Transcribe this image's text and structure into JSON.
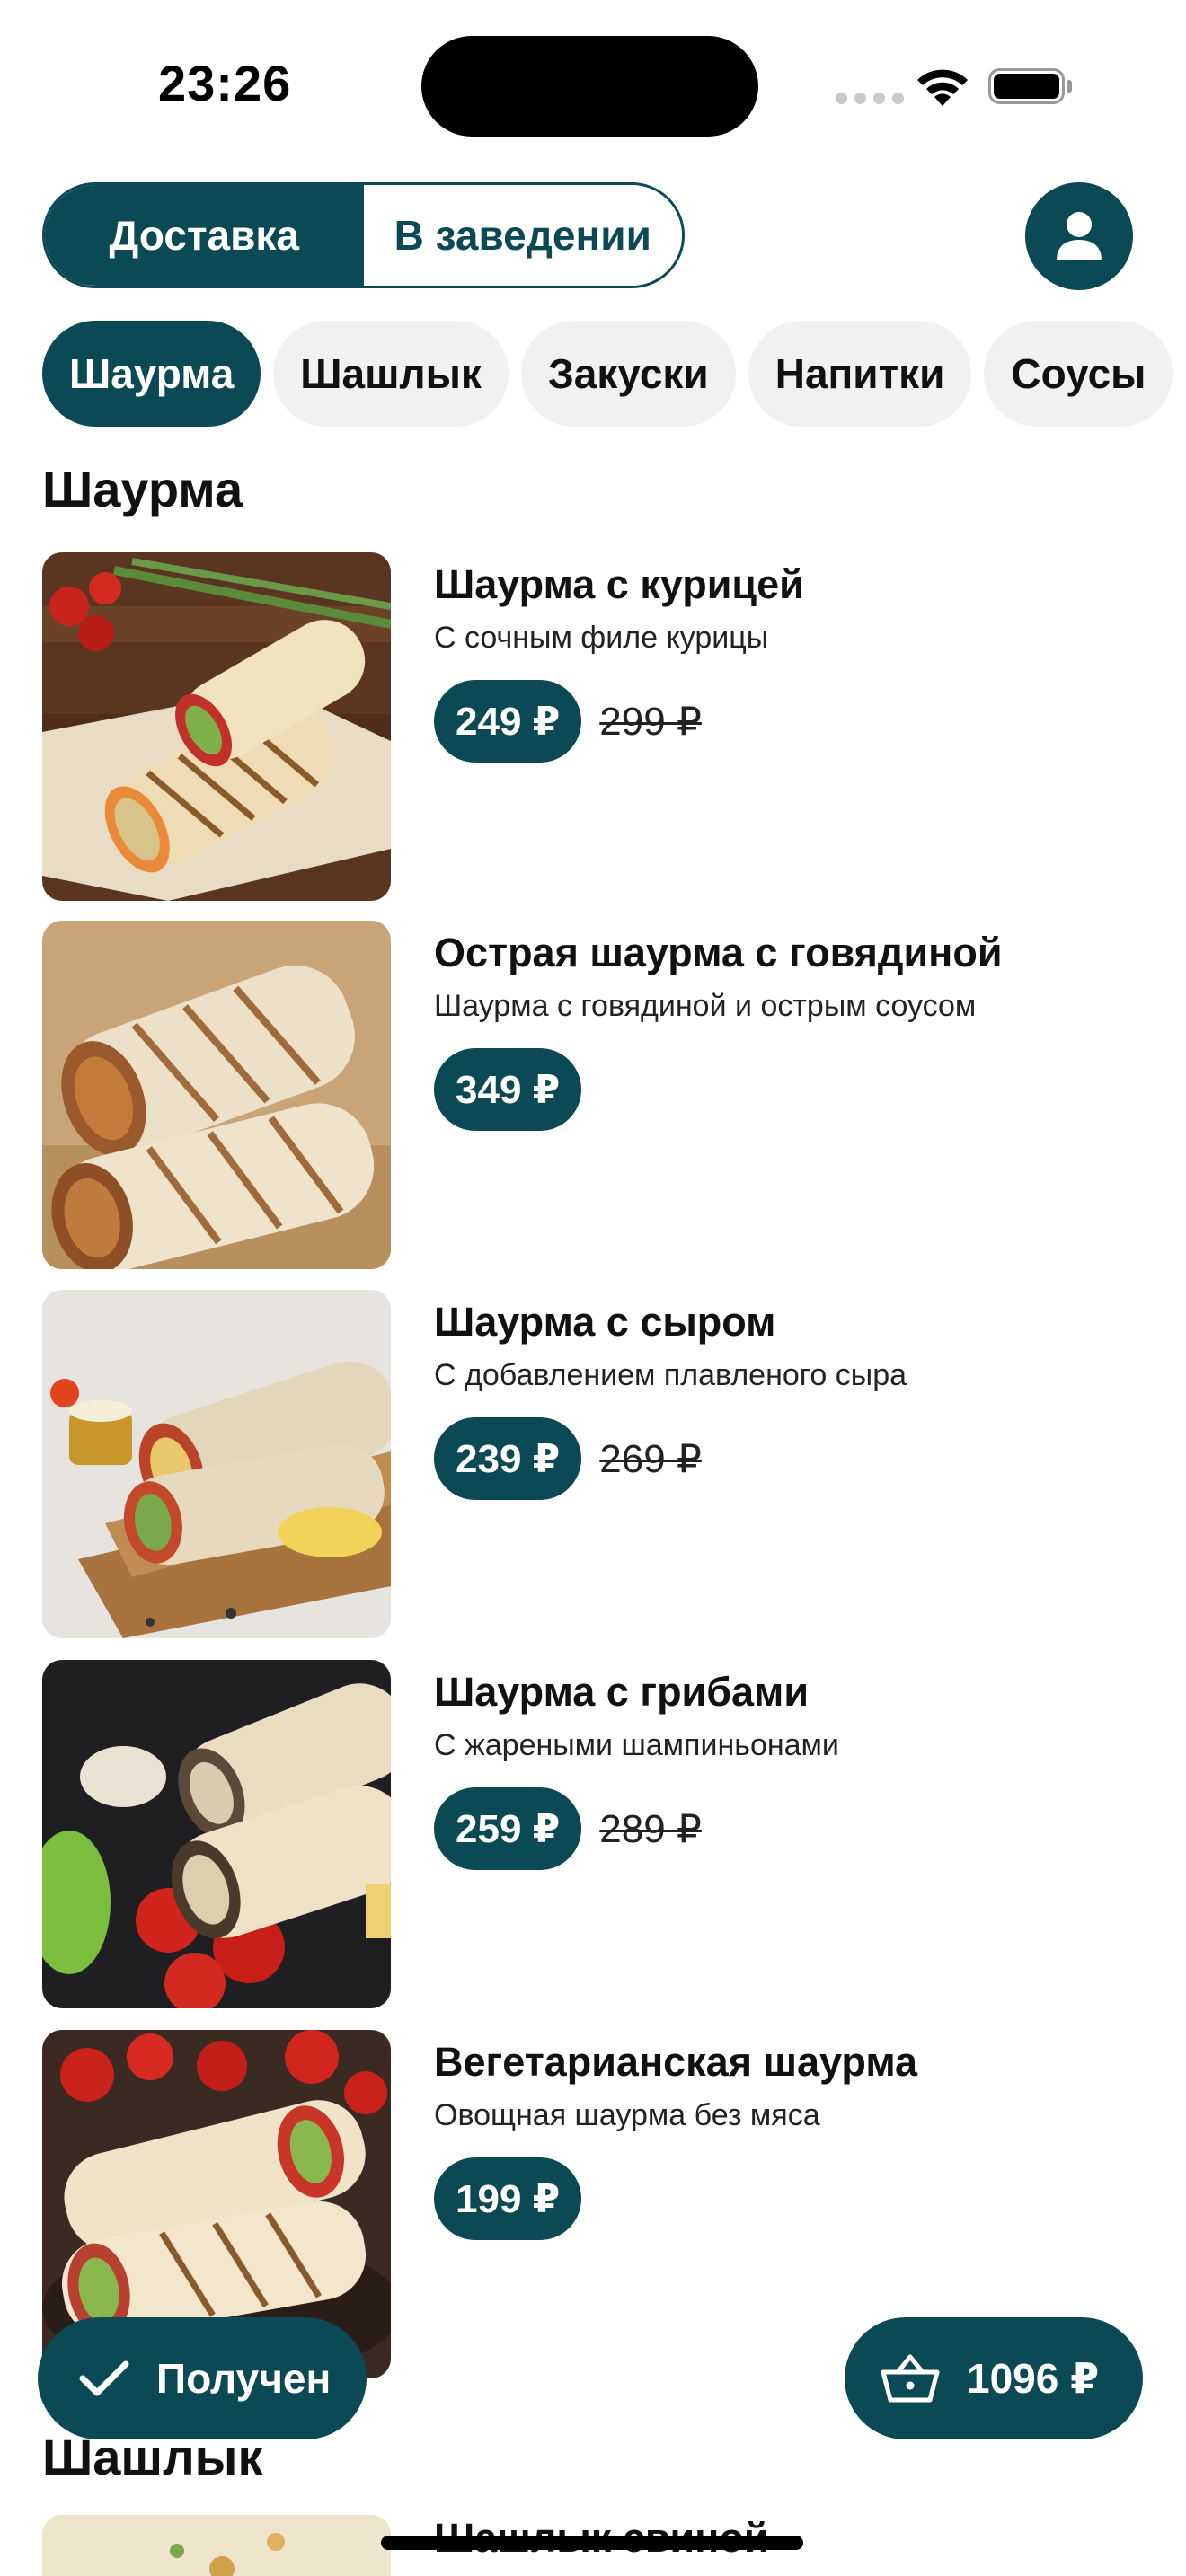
{
  "status_bar": {
    "time": "23:26"
  },
  "header": {
    "modes": [
      "Доставка",
      "В заведении"
    ],
    "active_mode": "Доставка"
  },
  "categories": [
    "Шаурма",
    "Шашлык",
    "Закуски",
    "Напитки",
    "Соусы"
  ],
  "sections": [
    {
      "title": "Шаурма",
      "items": [
        {
          "name": "Шаурма с курицей",
          "description": "С сочным филе курицы",
          "price": "249 ₽",
          "old_price": "299 ₽"
        },
        {
          "name": "Острая шаурма с говядиной",
          "description": "Шаурма с говядиной и острым соусом",
          "price": "349 ₽",
          "old_price": ""
        },
        {
          "name": "Шаурма с сыром",
          "description": "С добавлением плавленого сыра",
          "price": "239 ₽",
          "old_price": "269 ₽"
        },
        {
          "name": "Шаурма с грибами",
          "description": "С жареными шампиньонами",
          "price": "259 ₽",
          "old_price": "289 ₽"
        },
        {
          "name": "Вегетарианская шаурма",
          "description": "Овощная шаурма без мяса",
          "price": "199 ₽",
          "old_price": ""
        }
      ]
    },
    {
      "title": "Шашлык",
      "items": [
        {
          "name": "Шашлык свиной"
        }
      ]
    }
  ],
  "floating": {
    "received_label": "Получен",
    "cart_total": "1096 ₽"
  },
  "colors": {
    "accent": "#0b4a55",
    "chip_bg": "#f1f1f1"
  },
  "icons": {
    "profile": "person-icon",
    "received": "checkmark-icon",
    "cart": "basket-icon"
  }
}
